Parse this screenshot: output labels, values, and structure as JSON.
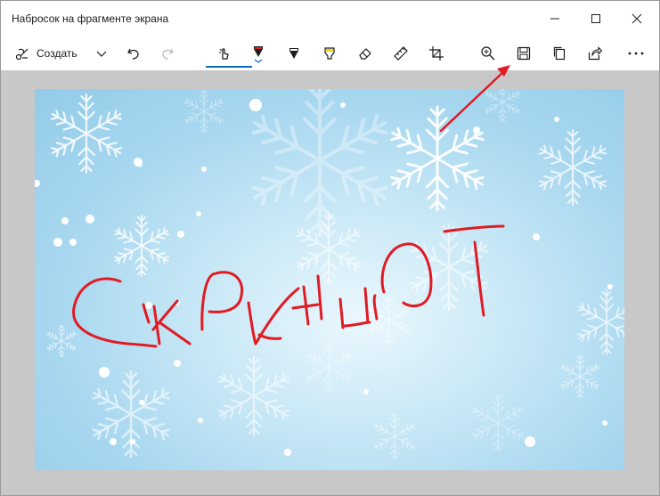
{
  "window": {
    "title": "Набросок на фрагменте экрана"
  },
  "toolbar": {
    "create_label": "Создать"
  },
  "colors": {
    "accent": "#0f6cbd",
    "ink_red": "#e01b24",
    "canvas_bg": "#c8c8c8"
  },
  "icons": {
    "create": "scissors-icon",
    "dropdown": "chevron-down-icon",
    "undo": "undo-icon",
    "redo": "redo-icon",
    "touch": "touch-writing-icon",
    "pen": "ballpoint-pen-icon",
    "pencil": "pencil-icon",
    "highlighter": "highlighter-icon",
    "eraser": "eraser-icon",
    "ruler": "ruler-icon",
    "crop": "crop-icon",
    "zoom": "zoom-in-icon",
    "save": "save-icon",
    "copy": "copy-icon",
    "share": "share-icon",
    "more": "more-icon"
  }
}
